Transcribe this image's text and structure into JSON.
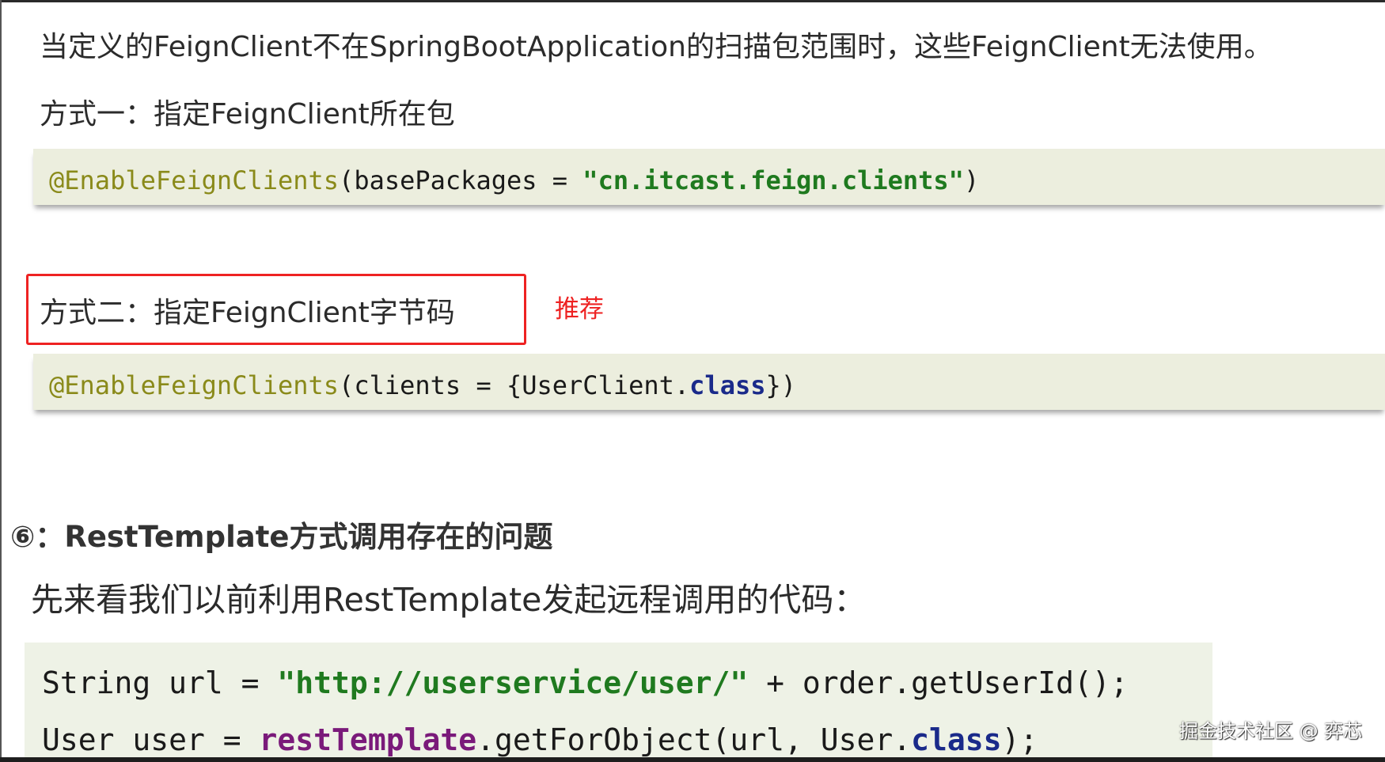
{
  "intro": "当定义的FeignClient不在SpringBootApplication的扫描包范围时，这些FeignClient无法使用。",
  "method1": {
    "title": "方式一：指定FeignClient所在包",
    "code": {
      "annotation": "@EnableFeignClients",
      "open": "(basePackages = ",
      "string": "\"cn.itcast.feign.clients\"",
      "close": ")"
    }
  },
  "method2": {
    "title": "方式二：指定FeignClient字节码",
    "badge": "推荐",
    "badge_color": "#ee2222",
    "code": {
      "annotation": "@EnableFeignClients",
      "open": "(clients = {UserClient.",
      "keyword": "class",
      "close": "})"
    }
  },
  "section6": {
    "heading": "⑥：RestTemplate方式调用存在的问题",
    "intro": "先来看我们以前利用RestTemplate发起远程调用的代码：",
    "code": {
      "line1": {
        "pre": "String url = ",
        "string": "\"http://userservice/user/\"",
        "post": " + order.getUserId();"
      },
      "line2": {
        "pre": "User user = ",
        "field": "restTemplate",
        "mid": ".getForObject(url, User.",
        "keyword": "class",
        "post": ");"
      }
    }
  },
  "watermark": "掘金技术社区 @ 弈芯"
}
